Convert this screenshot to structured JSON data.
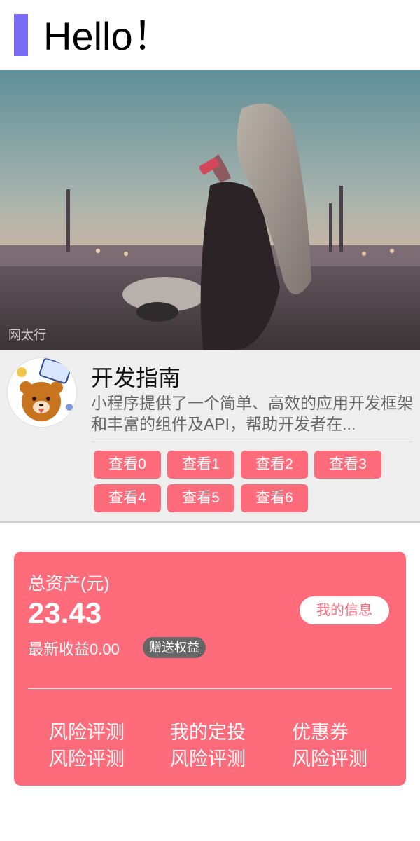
{
  "header": {
    "title": "Hello！",
    "accent": "#7b6cf6"
  },
  "banner": {
    "alt_icon": "banner-photo",
    "watermark": "网太行"
  },
  "card": {
    "title": "开发指南",
    "description": "小程序提供了一个简单、高效的应用开发框架和丰富的组件及API，帮助开发者在...",
    "buttons": [
      "查看0",
      "查看1",
      "查看2",
      "查看3",
      "查看4",
      "查看5",
      "查看6"
    ],
    "button_color": "#fe6b7a"
  },
  "asset": {
    "label": "总资产(元)",
    "amount": "23.43",
    "info_button": "我的信息",
    "profit": "最新收益0.00",
    "gift_badge": "赠送权益",
    "items": [
      {
        "label": "风险评测"
      },
      {
        "label": "我的定投"
      },
      {
        "label": "优惠券"
      },
      {
        "label": "风险评测"
      },
      {
        "label": "风险评测"
      },
      {
        "label": "风险评测"
      }
    ],
    "background": "#fe6b7a"
  }
}
